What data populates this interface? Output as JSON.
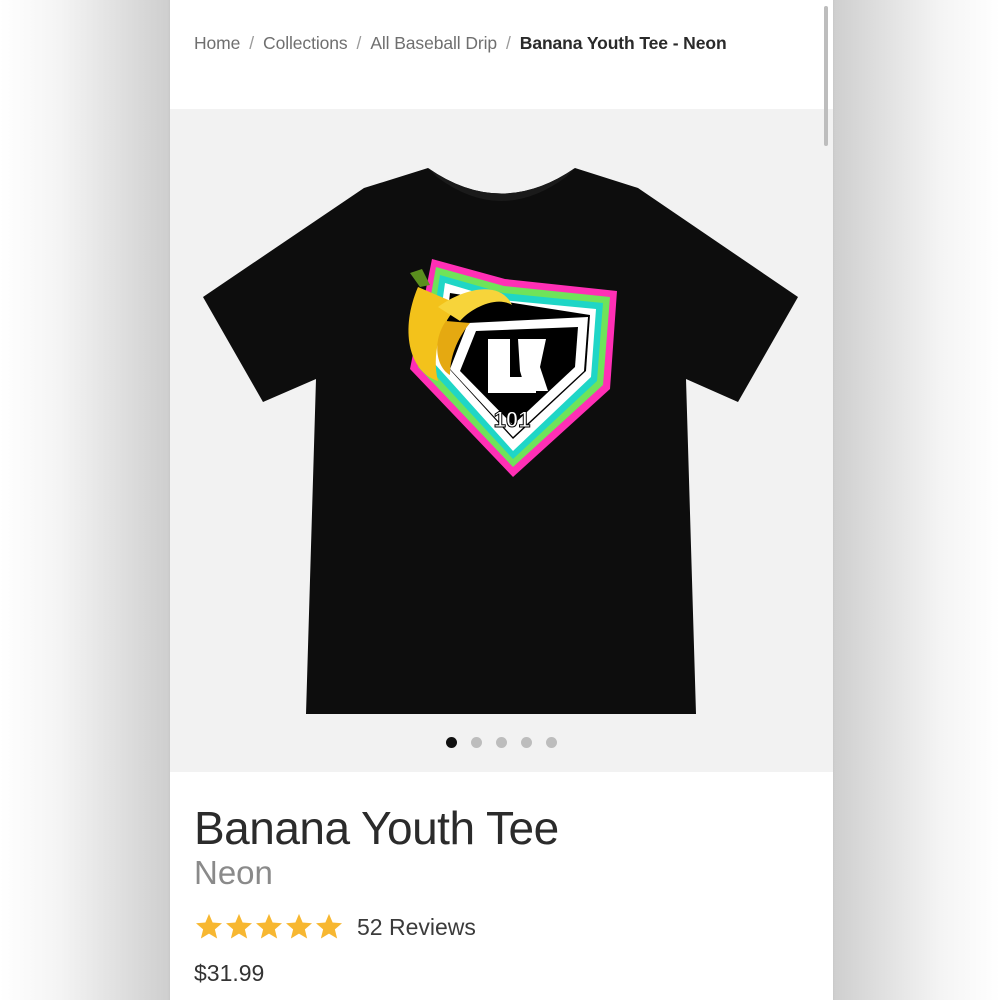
{
  "breadcrumb": {
    "items": [
      "Home",
      "Collections",
      "All Baseball Drip"
    ],
    "separator": "/",
    "current": "Banana Youth Tee - Neon"
  },
  "gallery": {
    "image_icon": "black-tshirt-banana-k101-logo-icon",
    "logo_text": "101",
    "slide_count": 5,
    "active_slide": 1
  },
  "product": {
    "title": "Banana Youth Tee",
    "variant": "Neon",
    "rating": 5,
    "reviews": "52 Reviews",
    "price": "$31.99"
  },
  "colors": {
    "star": "#f7b731",
    "shirt": "#0d0d0d",
    "neon_pink": "#ff2fb5",
    "neon_green": "#6fe35a",
    "neon_teal": "#1fd6c6"
  }
}
